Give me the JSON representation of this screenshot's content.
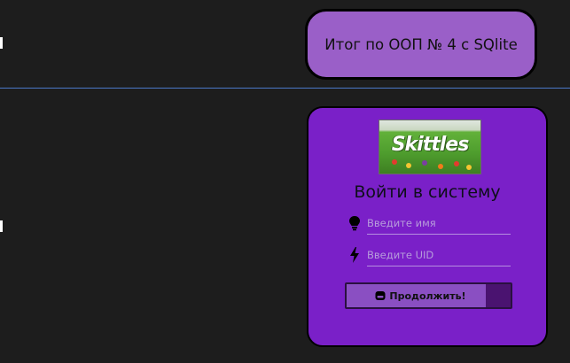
{
  "header": {
    "title": "Итог по ООП № 4 с SQlite"
  },
  "login": {
    "logo_text": "Skittles",
    "title": "Войти в систему",
    "name_field": {
      "placeholder": "Введите имя",
      "value": "",
      "icon": "lightbulb-icon"
    },
    "uid_field": {
      "placeholder": "Введите UID",
      "value": "",
      "icon": "lightning-icon"
    },
    "continue_button": {
      "label": "Продолжить!",
      "icon": "emoji-icon"
    }
  },
  "colors": {
    "background": "#1d1d1d",
    "divider": "#4a78c8",
    "header_card": "#9a5fc8",
    "login_card": "#7a20c8",
    "button": "#8a4fc2"
  }
}
